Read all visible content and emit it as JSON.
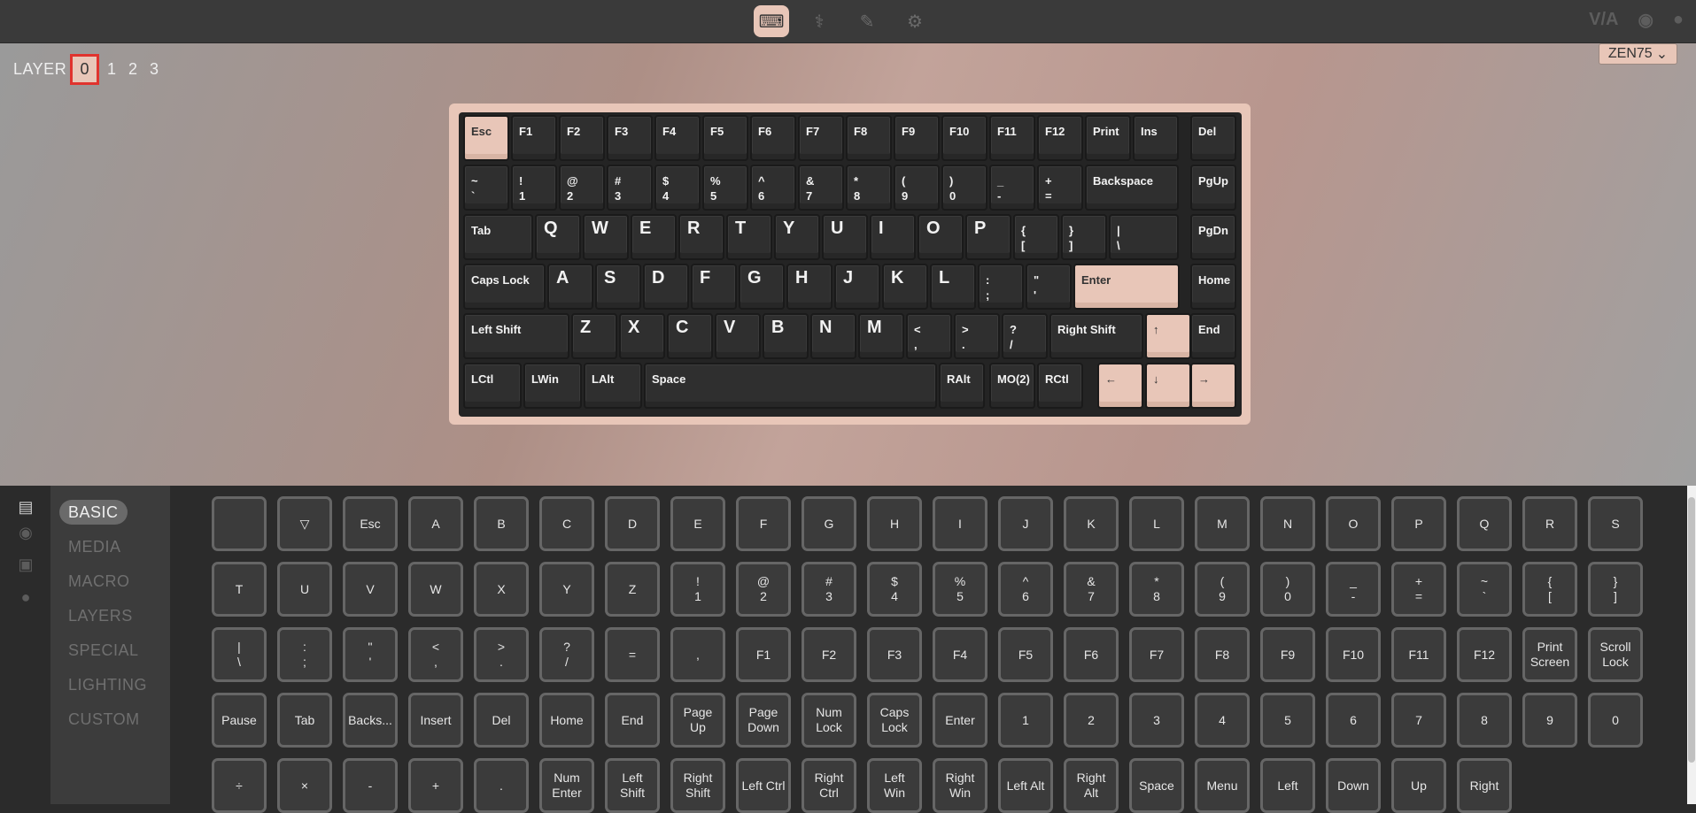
{
  "topbar": {
    "icons": [
      {
        "name": "keyboard-icon",
        "glyph": "⌨",
        "active": true
      },
      {
        "name": "stethoscope-icon",
        "glyph": "⚕",
        "active": false
      },
      {
        "name": "brush-icon",
        "glyph": "✎",
        "active": false
      },
      {
        "name": "gear-icon",
        "glyph": "⚙",
        "active": false
      }
    ],
    "right": {
      "via": "V/A",
      "discord": "◉",
      "github": "●"
    }
  },
  "layers": {
    "label": "LAYER",
    "items": [
      "0",
      "1",
      "2",
      "3"
    ],
    "selected": "0"
  },
  "device": {
    "name": "ZEN75",
    "chevron": "⌄"
  },
  "keyboard": {
    "rows": [
      [
        "Esc",
        "F1",
        "F2",
        "F3",
        "F4",
        "F5",
        "F6",
        "F7",
        "F8",
        "F9",
        "F10",
        "F11",
        "F12",
        "Print",
        "Ins",
        "Del"
      ],
      [
        "~|`",
        "!|1",
        "@|2",
        "#|3",
        "$|4",
        "%|5",
        "^|6",
        "&|7",
        "*|8",
        "(|9",
        ")|0",
        "_|-",
        "+|=",
        "Backspace",
        "PgUp"
      ],
      [
        "Tab",
        "Q",
        "W",
        "E",
        "R",
        "T",
        "Y",
        "U",
        "I",
        "O",
        "P",
        "{|[",
        "}|]",
        "\\||\\",
        "PgDn"
      ],
      [
        "Caps Lock",
        "A",
        "S",
        "D",
        "F",
        "G",
        "H",
        "J",
        "K",
        "L",
        ":|;",
        "\"|'",
        "Enter",
        "Home"
      ],
      [
        "Left Shift",
        "Z",
        "X",
        "C",
        "V",
        "B",
        "N",
        "M",
        "<|,",
        ">|.",
        "?|/",
        "Right Shift",
        "↑",
        "End"
      ],
      [
        "LCtl",
        "LWin",
        "LAlt",
        "Space",
        "RAlt",
        "MO(2)",
        "RCtl",
        "←",
        "↓",
        "→"
      ]
    ]
  },
  "sidebar": {
    "icons": [
      "book-icon",
      "circle-icon",
      "save-icon",
      "bulb-icon"
    ],
    "items": [
      "BASIC",
      "MEDIA",
      "MACRO",
      "LAYERS",
      "SPECIAL",
      "LIGHTING",
      "CUSTOM"
    ],
    "selected": "BASIC"
  },
  "keycodes": [
    [
      "",
      "▽",
      "Esc",
      "A",
      "B",
      "C",
      "D",
      "E",
      "F",
      "G",
      "H",
      "I",
      "J",
      "K",
      "L",
      "M",
      "N",
      "O",
      "P",
      "Q",
      "R",
      "S"
    ],
    [
      "T",
      "U",
      "V",
      "W",
      "X",
      "Y",
      "Z",
      "!\n1",
      "@\n2",
      "#\n3",
      "$\n4",
      "%\n5",
      "^\n6",
      "&\n7",
      "*\n8",
      "(\n9",
      ")\n0",
      "_\n-",
      "+\n=",
      "~\n`",
      "{\n[",
      "}\n]"
    ],
    [
      "|\n\\",
      ":\n;",
      "\"\n'",
      "<\n,",
      ">\n.",
      "?\n/",
      "=",
      ",",
      "F1",
      "F2",
      "F3",
      "F4",
      "F5",
      "F6",
      "F7",
      "F8",
      "F9",
      "F10",
      "F11",
      "F12",
      "Print\nScreen",
      "Scroll\nLock"
    ],
    [
      "Pause",
      "Tab",
      "Backs...",
      "Insert",
      "Del",
      "Home",
      "End",
      "Page\nUp",
      "Page\nDown",
      "Num\nLock",
      "Caps\nLock",
      "Enter",
      "1",
      "2",
      "3",
      "4",
      "5",
      "6",
      "7",
      "8",
      "9",
      "0"
    ],
    [
      "÷",
      "×",
      "-",
      "+",
      ".",
      "Num\nEnter",
      "Left\nShift",
      "Right\nShift",
      "Left Ctrl",
      "Right\nCtrl",
      "Left\nWin",
      "Right\nWin",
      "Left Alt",
      "Right\nAlt",
      "Space",
      "Menu",
      "Left",
      "Down",
      "Up",
      "Right"
    ]
  ]
}
